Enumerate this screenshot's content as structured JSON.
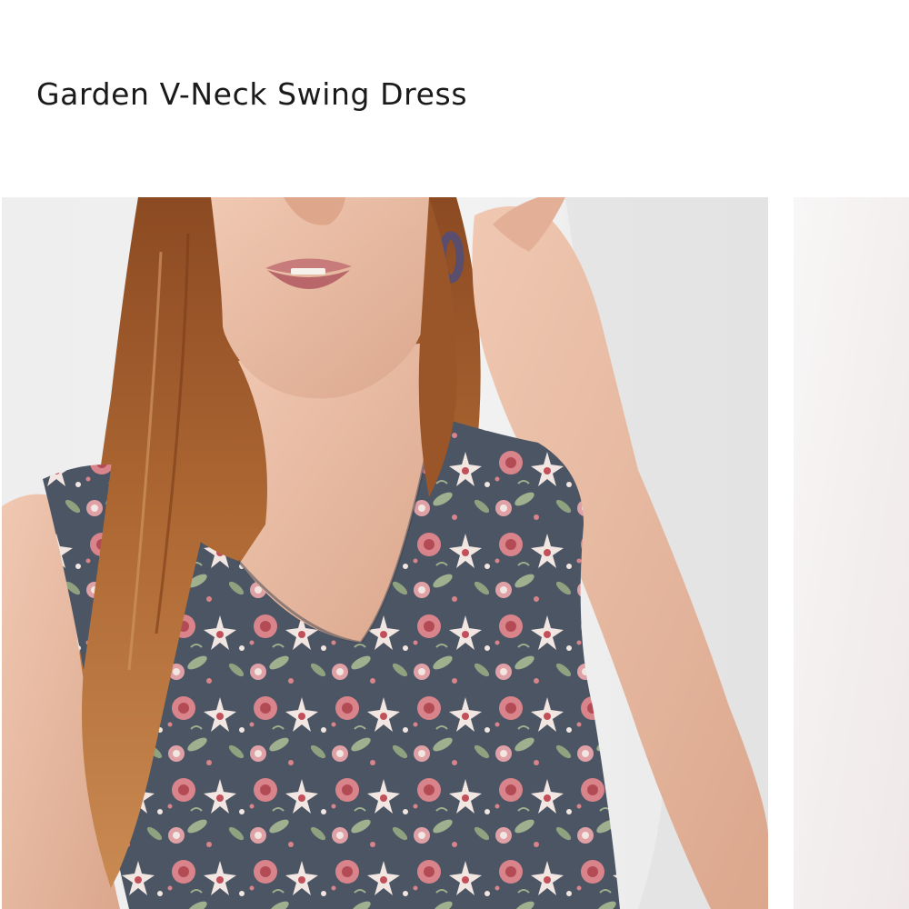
{
  "product": {
    "title": "Garden V-Neck Swing Dress"
  },
  "gallery": {
    "images": [
      {
        "subject": "model-wearing-floral-dress"
      },
      {
        "subject": "next-product-image"
      }
    ]
  },
  "colors": {
    "title_text": "#1a1a1a",
    "page_background": "#ffffff",
    "photo_background": "#efefef",
    "dress_base": "#4b5563",
    "floral_pink": "#d9838b",
    "floral_cream": "#f1e6e1",
    "floral_green": "#9fb08f",
    "hair": "#a35d2c",
    "skin": "#e9bba3"
  }
}
